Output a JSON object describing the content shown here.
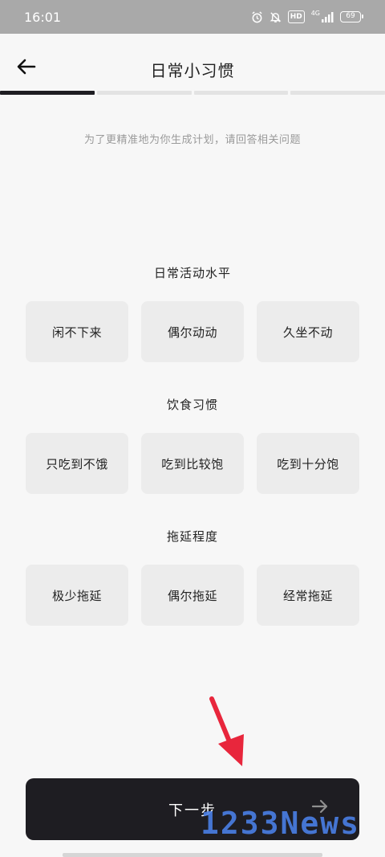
{
  "status_bar": {
    "time": "16:01",
    "signal_label": "4G",
    "hd_label": "HD",
    "battery": "69",
    "icons": [
      "alarm-icon",
      "mute-icon",
      "hd-icon",
      "signal-icon",
      "battery-icon"
    ]
  },
  "header": {
    "back_icon": "arrow-left-icon",
    "title": "日常小习惯",
    "progress_step": 1,
    "progress_total": 4
  },
  "subtitle": "为了更精准地为你生成计划，请回答相关问题",
  "sections": [
    {
      "title": "日常活动水平",
      "options": [
        "闲不下来",
        "偶尔动动",
        "久坐不动"
      ]
    },
    {
      "title": "饮食习惯",
      "options": [
        "只吃到不饿",
        "吃到比较饱",
        "吃到十分饱"
      ]
    },
    {
      "title": "拖延程度",
      "options": [
        "极少拖延",
        "偶尔拖延",
        "经常拖延"
      ]
    }
  ],
  "next_button": {
    "label": "下一步",
    "icon": "arrow-right-icon"
  },
  "annotation": {
    "icon": "red-arrow-icon",
    "color": "#e8263c"
  },
  "watermark": "1233News",
  "colors": {
    "primary": "#1e1d22",
    "option_bg": "#ececec",
    "background": "#f7f7f7",
    "watermark": "#4a7fe6"
  }
}
